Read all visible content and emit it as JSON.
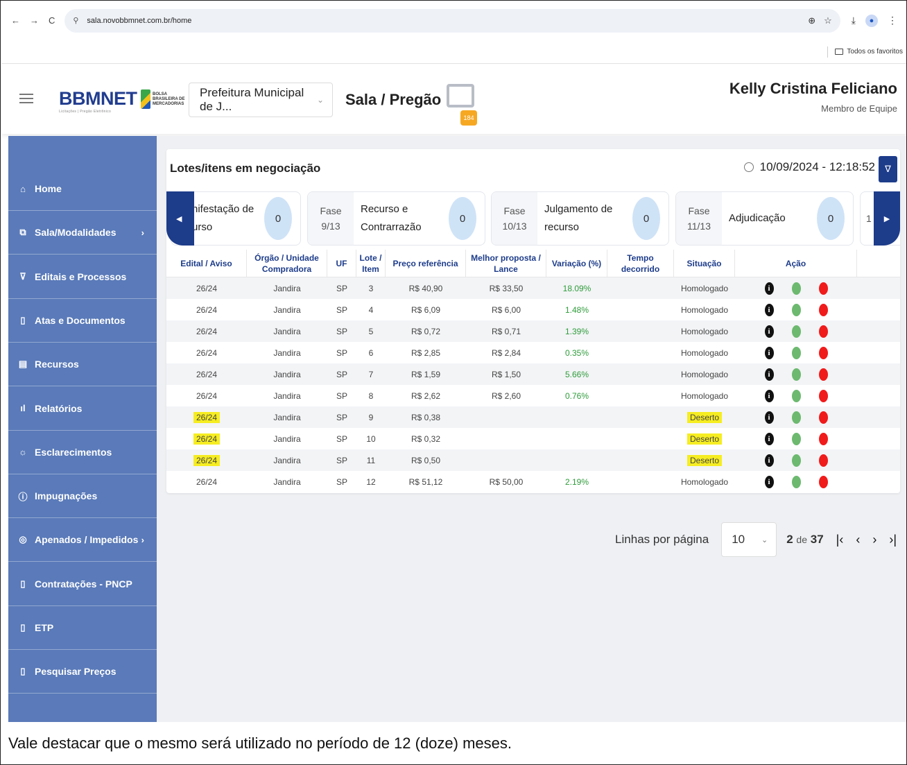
{
  "browser": {
    "url": "sala.novobbmnet.com.br/home",
    "bookmarks_label": "Todos os favoritos"
  },
  "header": {
    "logo_text": "BBMNET",
    "logo_subtitle": "Licitações | Pregão Eletrônico",
    "bolsa_lines": [
      "BOLSA",
      "BRASILEIRA DE",
      "MERCADORIAS"
    ],
    "entity": "Prefeitura Municipal de J...",
    "page_title": "Sala / Pregão",
    "mail_count": "184",
    "user_name": "Kelly Cristina Feliciano",
    "user_role": "Membro de Equipe"
  },
  "sidebar": {
    "items": [
      {
        "label": "Home",
        "icon": "home-icon",
        "glyph": "⌂",
        "arrow": ""
      },
      {
        "label": "Sala/Modalidades",
        "icon": "rooms-icon",
        "glyph": "⧉",
        "arrow": "›"
      },
      {
        "label": "Editais e Processos",
        "icon": "cart-icon",
        "glyph": "⊽",
        "arrow": ""
      },
      {
        "label": "Atas e Documentos",
        "icon": "document-icon",
        "glyph": "▯",
        "arrow": ""
      },
      {
        "label": "Recursos",
        "icon": "archive-icon",
        "glyph": "▤",
        "arrow": ""
      },
      {
        "label": "Relatórios",
        "icon": "bar-chart-icon",
        "glyph": "ıl",
        "arrow": ""
      },
      {
        "label": "Esclarecimentos",
        "icon": "sun-icon",
        "glyph": "☼",
        "arrow": ""
      },
      {
        "label": "Impugnações",
        "icon": "alert-circle-icon",
        "glyph": "ⓘ",
        "arrow": ""
      },
      {
        "label": "Apenados / Impedidos",
        "icon": "block-icon",
        "glyph": "◎",
        "arrow": "›"
      },
      {
        "label": "Contratações - PNCP",
        "icon": "file-text-icon",
        "glyph": "▯",
        "arrow": ""
      },
      {
        "label": "ETP",
        "icon": "file-text-icon",
        "glyph": "▯",
        "arrow": ""
      },
      {
        "label": "Pesquisar Preços",
        "icon": "document-icon",
        "glyph": "▯",
        "arrow": ""
      }
    ]
  },
  "panel": {
    "title": "Lotes/itens em negociação",
    "datetime": "10/09/2024 - 12:18:52"
  },
  "phases": [
    {
      "num_label": "",
      "num": "",
      "name_lines": [
        "nifestação de",
        "urso"
      ],
      "count": "0"
    },
    {
      "num_label": "Fase",
      "num": "9/13",
      "name_lines": [
        "Recurso e",
        "Contrarrazão"
      ],
      "count": "0"
    },
    {
      "num_label": "Fase",
      "num": "10/13",
      "name_lines": [
        "Julgamento de",
        "recurso"
      ],
      "count": "0"
    },
    {
      "num_label": "Fase",
      "num": "11/13",
      "name_lines": [
        "Adjudicação",
        ""
      ],
      "count": "0"
    }
  ],
  "phase_peek": "1",
  "table": {
    "columns": [
      "Edital / Aviso",
      "Órgão / Unidade Compradora",
      "UF",
      "Lote / Item",
      "Preço referência",
      "Melhor proposta / Lance",
      "Variação (%)",
      "Tempo decorrido",
      "Situação",
      "Ação"
    ],
    "rows": [
      {
        "edital": "26/24",
        "orgao": "Jandira",
        "uf": "SP",
        "item": "3",
        "preco": "R$ 40,90",
        "proposta": "R$ 33,50",
        "variacao": "18.09%",
        "tempo": "",
        "situacao": "Homologado",
        "highlight": false
      },
      {
        "edital": "26/24",
        "orgao": "Jandira",
        "uf": "SP",
        "item": "4",
        "preco": "R$ 6,09",
        "proposta": "R$ 6,00",
        "variacao": "1.48%",
        "tempo": "",
        "situacao": "Homologado",
        "highlight": false
      },
      {
        "edital": "26/24",
        "orgao": "Jandira",
        "uf": "SP",
        "item": "5",
        "preco": "R$ 0,72",
        "proposta": "R$ 0,71",
        "variacao": "1.39%",
        "tempo": "",
        "situacao": "Homologado",
        "highlight": false
      },
      {
        "edital": "26/24",
        "orgao": "Jandira",
        "uf": "SP",
        "item": "6",
        "preco": "R$ 2,85",
        "proposta": "R$ 2,84",
        "variacao": "0.35%",
        "tempo": "",
        "situacao": "Homologado",
        "highlight": false
      },
      {
        "edital": "26/24",
        "orgao": "Jandira",
        "uf": "SP",
        "item": "7",
        "preco": "R$ 1,59",
        "proposta": "R$ 1,50",
        "variacao": "5.66%",
        "tempo": "",
        "situacao": "Homologado",
        "highlight": false
      },
      {
        "edital": "26/24",
        "orgao": "Jandira",
        "uf": "SP",
        "item": "8",
        "preco": "R$ 2,62",
        "proposta": "R$ 2,60",
        "variacao": "0.76%",
        "tempo": "",
        "situacao": "Homologado",
        "highlight": false
      },
      {
        "edital": "26/24",
        "orgao": "Jandira",
        "uf": "SP",
        "item": "9",
        "preco": "R$ 0,38",
        "proposta": "",
        "variacao": "",
        "tempo": "",
        "situacao": "Deserto",
        "highlight": true
      },
      {
        "edital": "26/24",
        "orgao": "Jandira",
        "uf": "SP",
        "item": "10",
        "preco": "R$ 0,32",
        "proposta": "",
        "variacao": "",
        "tempo": "",
        "situacao": "Deserto",
        "highlight": true
      },
      {
        "edital": "26/24",
        "orgao": "Jandira",
        "uf": "SP",
        "item": "11",
        "preco": "R$ 0,50",
        "proposta": "",
        "variacao": "",
        "tempo": "",
        "situacao": "Deserto",
        "highlight": true
      },
      {
        "edital": "26/24",
        "orgao": "Jandira",
        "uf": "SP",
        "item": "12",
        "preco": "R$ 51,12",
        "proposta": "R$ 50,00",
        "variacao": "2.19%",
        "tempo": "",
        "situacao": "Homologado",
        "highlight": false
      }
    ]
  },
  "pager": {
    "rows_label": "Linhas por página",
    "rows_value": "10",
    "current_page": "2",
    "of_label": "de",
    "total_pages": "37"
  },
  "footer_text": "Vale destacar que o mesmo será utilizado no período de 12 (doze) meses.",
  "colors": {
    "sidebar": "#5a7ab9",
    "primary": "#1d3c8a",
    "badge": "#f6a823",
    "highlight": "#f6ed22"
  }
}
